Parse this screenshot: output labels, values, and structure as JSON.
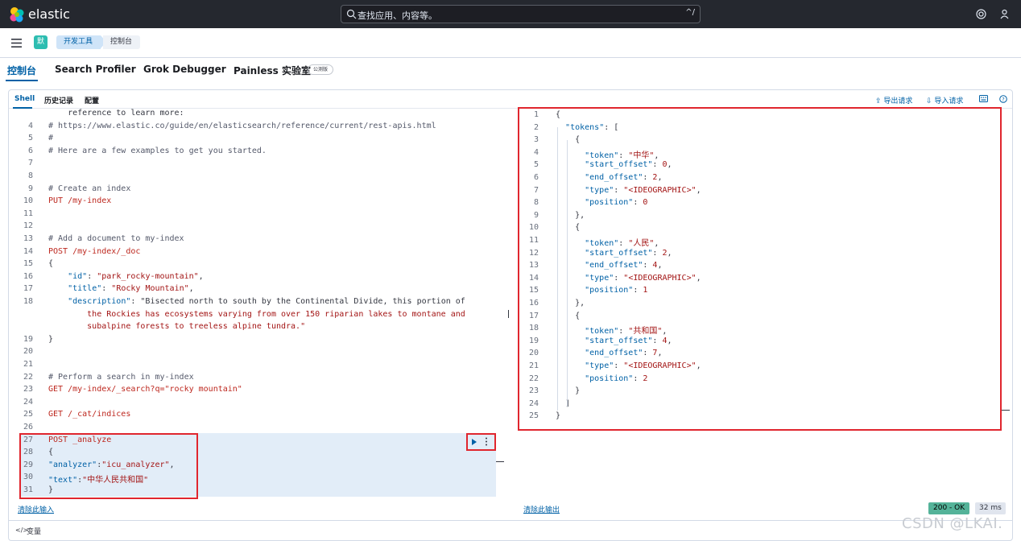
{
  "header": {
    "brand": "elastic",
    "search_placeholder": "查找应用、内容等。",
    "search_shortcut": "^/"
  },
  "breadcrumb": {
    "space_avatar": "默",
    "items": [
      "开发工具",
      "控制台"
    ]
  },
  "app_tabs": [
    {
      "label": "控制台",
      "active": true
    },
    {
      "label": "Search Profiler"
    },
    {
      "label": "Grok Debugger"
    },
    {
      "label": "Painless 实验室",
      "badge": "公测版"
    }
  ],
  "subnav": {
    "tabs": [
      "Shell",
      "历史记录",
      "配置"
    ],
    "export_label": "导出请求",
    "import_label": "导入请求"
  },
  "request_editor": {
    "lines": [
      {
        "n": "",
        "text": "    reference to learn more:"
      },
      {
        "n": "4",
        "text": "# https://www.elastic.co/guide/en/elasticsearch/reference/current/rest-apis.html"
      },
      {
        "n": "5",
        "text": "#"
      },
      {
        "n": "6",
        "text": "# Here are a few examples to get you started."
      },
      {
        "n": "7",
        "text": ""
      },
      {
        "n": "8",
        "text": ""
      },
      {
        "n": "9",
        "text": "# Create an index"
      },
      {
        "n": "10",
        "text": "PUT /my-index"
      },
      {
        "n": "11",
        "text": ""
      },
      {
        "n": "12",
        "text": ""
      },
      {
        "n": "13",
        "text": "# Add a document to my-index"
      },
      {
        "n": "14",
        "text": "POST /my-index/_doc"
      },
      {
        "n": "15",
        "text": "{"
      },
      {
        "n": "16",
        "text": "    \"id\": \"park_rocky-mountain\","
      },
      {
        "n": "17",
        "text": "    \"title\": \"Rocky Mountain\","
      },
      {
        "n": "18",
        "text": "    \"description\": \"Bisected north to south by the Continental Divide, this portion of"
      },
      {
        "n": "",
        "text": "        the Rockies has ecosystems varying from over 150 riparian lakes to montane and"
      },
      {
        "n": "",
        "text": "        subalpine forests to treeless alpine tundra.\""
      },
      {
        "n": "19",
        "text": "}"
      },
      {
        "n": "20",
        "text": ""
      },
      {
        "n": "21",
        "text": ""
      },
      {
        "n": "22",
        "text": "# Perform a search in my-index"
      },
      {
        "n": "23",
        "text": "GET /my-index/_search?q=\"rocky mountain\""
      },
      {
        "n": "24",
        "text": ""
      },
      {
        "n": "25",
        "text": "GET /_cat/indices"
      },
      {
        "n": "26",
        "text": ""
      },
      {
        "n": "27",
        "text": "POST _analyze"
      },
      {
        "n": "28",
        "text": "{"
      },
      {
        "n": "29",
        "text": "\"analyzer\":\"icu_analyzer\","
      },
      {
        "n": "30",
        "text": "\"text\":\"中华人民共和国\""
      },
      {
        "n": "31",
        "text": "}"
      }
    ],
    "clear_label": "清除此输入"
  },
  "response_editor": {
    "lines": [
      {
        "n": "1",
        "text": "{"
      },
      {
        "n": "2",
        "text": "  \"tokens\": ["
      },
      {
        "n": "3",
        "text": "    {"
      },
      {
        "n": "4",
        "text": "      \"token\": \"中华\","
      },
      {
        "n": "5",
        "text": "      \"start_offset\": 0,"
      },
      {
        "n": "6",
        "text": "      \"end_offset\": 2,"
      },
      {
        "n": "7",
        "text": "      \"type\": \"<IDEOGRAPHIC>\","
      },
      {
        "n": "8",
        "text": "      \"position\": 0"
      },
      {
        "n": "9",
        "text": "    },"
      },
      {
        "n": "10",
        "text": "    {"
      },
      {
        "n": "11",
        "text": "      \"token\": \"人民\","
      },
      {
        "n": "12",
        "text": "      \"start_offset\": 2,"
      },
      {
        "n": "13",
        "text": "      \"end_offset\": 4,"
      },
      {
        "n": "14",
        "text": "      \"type\": \"<IDEOGRAPHIC>\","
      },
      {
        "n": "15",
        "text": "      \"position\": 1"
      },
      {
        "n": "16",
        "text": "    },"
      },
      {
        "n": "17",
        "text": "    {"
      },
      {
        "n": "18",
        "text": "      \"token\": \"共和国\","
      },
      {
        "n": "19",
        "text": "      \"start_offset\": 4,"
      },
      {
        "n": "20",
        "text": "      \"end_offset\": 7,"
      },
      {
        "n": "21",
        "text": "      \"type\": \"<IDEOGRAPHIC>\","
      },
      {
        "n": "22",
        "text": "      \"position\": 2"
      },
      {
        "n": "23",
        "text": "    }"
      },
      {
        "n": "24",
        "text": "  ]"
      },
      {
        "n": "25",
        "text": "}"
      }
    ],
    "clear_label": "清除此输出",
    "status": "200 - OK",
    "time": "32 ms"
  },
  "footer": {
    "variables_icon": "</>",
    "variables_label": "变量"
  },
  "watermark": "CSDN @LKAI.",
  "colors": {
    "accent": "#0061a6",
    "header_bg": "#25282f",
    "highlight_box": "#e0262e",
    "status_ok": "#54b399"
  }
}
